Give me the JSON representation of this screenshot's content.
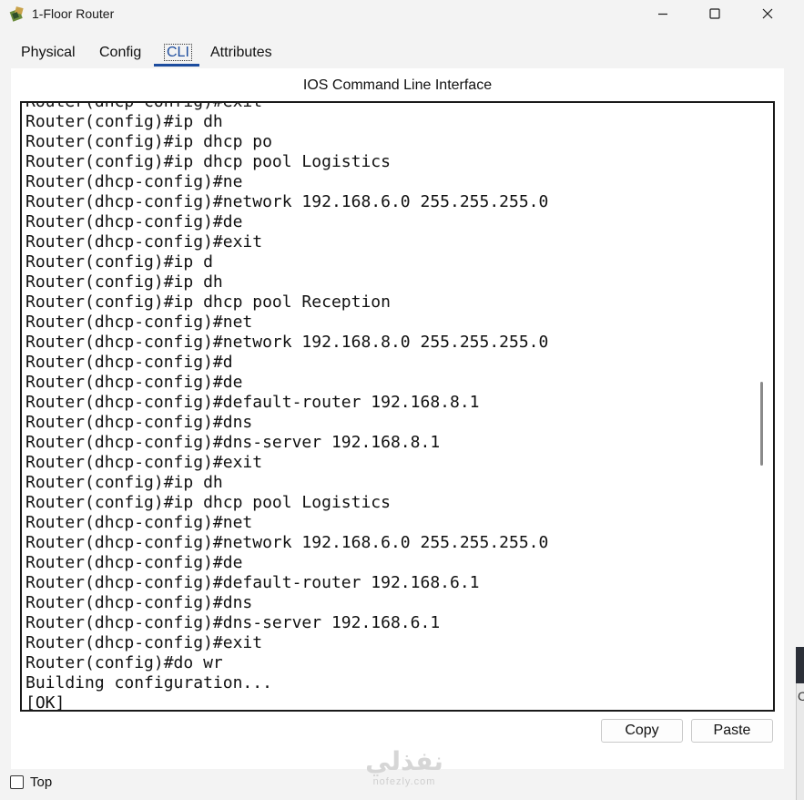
{
  "window": {
    "title": "1-Floor Router",
    "minimize_icon": "minimize-icon",
    "maximize_icon": "maximize-icon",
    "close_icon": "close-icon"
  },
  "tabs": [
    {
      "label": "Physical"
    },
    {
      "label": "Config"
    },
    {
      "label": "CLI",
      "active": true
    },
    {
      "label": "Attributes"
    }
  ],
  "panel": {
    "title": "IOS Command Line Interface"
  },
  "cli": {
    "lines": [
      "Router(dhcp-config)#exit",
      "Router(config)#ip dh",
      "Router(config)#ip dhcp po",
      "Router(config)#ip dhcp pool Logistics",
      "Router(dhcp-config)#ne",
      "Router(dhcp-config)#network 192.168.6.0 255.255.255.0",
      "Router(dhcp-config)#de",
      "Router(dhcp-config)#exit",
      "Router(config)#ip d",
      "Router(config)#ip dh",
      "Router(config)#ip dhcp pool Reception",
      "Router(dhcp-config)#net",
      "Router(dhcp-config)#network 192.168.8.0 255.255.255.0",
      "Router(dhcp-config)#d",
      "Router(dhcp-config)#de",
      "Router(dhcp-config)#default-router 192.168.8.1",
      "Router(dhcp-config)#dns",
      "Router(dhcp-config)#dns-server 192.168.8.1",
      "Router(dhcp-config)#exit",
      "Router(config)#ip dh",
      "Router(config)#ip dhcp pool Logistics",
      "Router(dhcp-config)#net",
      "Router(dhcp-config)#network 192.168.6.0 255.255.255.0",
      "Router(dhcp-config)#de",
      "Router(dhcp-config)#default-router 192.168.6.1",
      "Router(dhcp-config)#dns",
      "Router(dhcp-config)#dns-server 192.168.6.1",
      "Router(dhcp-config)#exit",
      "Router(config)#do wr",
      "Building configuration...",
      "[OK]"
    ]
  },
  "buttons": {
    "copy": "Copy",
    "paste": "Paste"
  },
  "footer": {
    "top_checkbox_label": "Top",
    "top_checked": false
  },
  "watermark": {
    "logo": "نفذلي",
    "url": "nofezly.com"
  },
  "right_edge_char": "C"
}
